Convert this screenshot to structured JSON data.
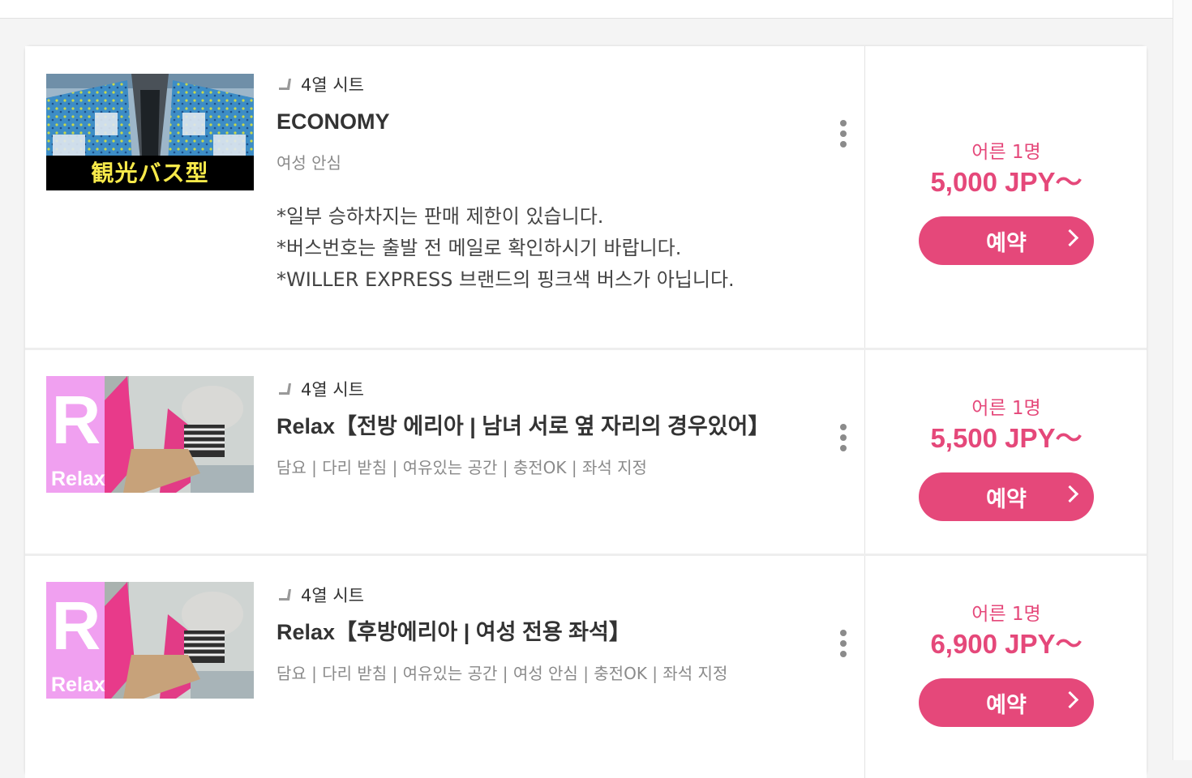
{
  "colors": {
    "accent": "#e5487a",
    "relax_pink": "#f0a0f0",
    "seat_blue": "#3d8dc6"
  },
  "plans": [
    {
      "seat_type": "4열 시트",
      "title": "ECONOMY",
      "tags": "여성 안심",
      "notes": [
        "*일부 승하차지는 판매 제한이 있습니다.",
        "*버스번호는 출발 전 메일로 확인하시기 바랍니다.",
        "*WILLER EXPRESS 브랜드의 핑크색 버스가 아닙니다."
      ],
      "image_caption": "観光バス型",
      "pax_label": "어른 1명",
      "price": "5,000 JPY～",
      "reserve_label": "예약"
    },
    {
      "seat_type": "4열 시트",
      "title": "Relax【전방 에리아 | 남녀 서로 옆 자리의 경우있어】",
      "tags": "담요 | 다리 받침 | 여유있는 공간 | 충전OK | 좌석 지정",
      "image_letter": "R",
      "image_caption": "Relax",
      "pax_label": "어른 1명",
      "price": "5,500 JPY～",
      "reserve_label": "예약"
    },
    {
      "seat_type": "4열 시트",
      "title": "Relax【후방에리아 | 여성 전용 좌석】",
      "tags": "담요 | 다리 받침 | 여유있는 공간 | 여성 안심 | 충전OK | 좌석 지정",
      "image_letter": "R",
      "image_caption": "Relax",
      "pax_label": "어른 1명",
      "price": "6,900 JPY～",
      "reserve_label": "예약"
    }
  ]
}
